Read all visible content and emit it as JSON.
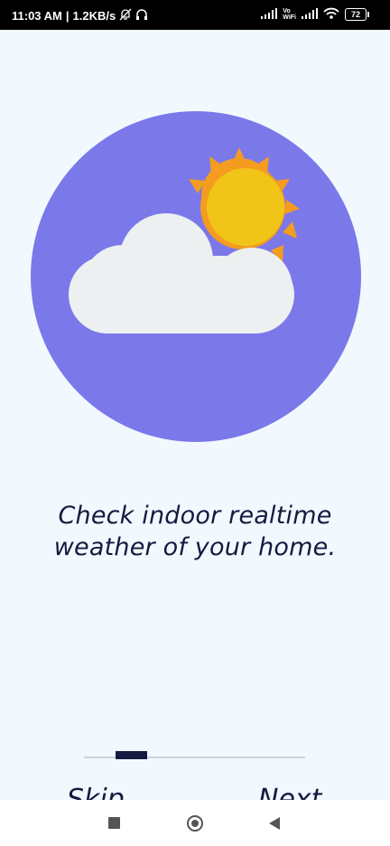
{
  "status_bar": {
    "time": "11:03 AM",
    "separator": "|",
    "network_speed": "1.2KB/s",
    "battery_level": "72",
    "icons": [
      "mute-icon",
      "headphones-icon",
      "signal-icon",
      "vowifi-icon",
      "signal-icon",
      "wifi-icon",
      "battery-icon"
    ],
    "vowifi_label_top": "Vo",
    "vowifi_label_bottom": "WiFi"
  },
  "onboarding": {
    "illustration": "cloud-sun-icon",
    "tagline": "Check indoor realtime weather of your home.",
    "page_count": 3,
    "current_page": 1,
    "skip_label": "Skip",
    "next_label": "Next"
  },
  "nav_bar": {
    "items": [
      "recents-icon",
      "home-icon",
      "back-icon"
    ]
  },
  "colors": {
    "background": "#f1f9fe",
    "circle": "#7b78ea",
    "cloud": "#ecf0f1",
    "sun_core": "#f1c518",
    "sun_rays": "#f39c1f",
    "text": "#141a40",
    "indicator_track": "#c9d2df"
  }
}
